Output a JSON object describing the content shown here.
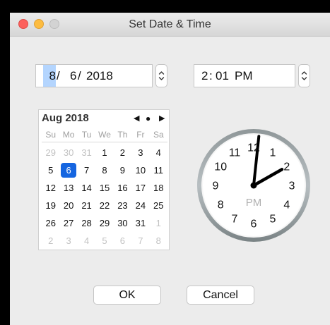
{
  "window": {
    "title": "Set Date & Time"
  },
  "date": {
    "month": "8",
    "day": "6",
    "year": "2018",
    "sep1": "/",
    "sep2": "/"
  },
  "time": {
    "hour": "2",
    "minute": "01",
    "ampm": "PM",
    "sep": ":"
  },
  "calendar": {
    "month_label": "Aug 2018",
    "nav_prev": "◀",
    "nav_today": "●",
    "nav_next": "▶",
    "weekdays": [
      "Su",
      "Mo",
      "Tu",
      "We",
      "Th",
      "Fr",
      "Sa"
    ],
    "weeks": [
      [
        "29",
        "30",
        "31",
        "1",
        "2",
        "3",
        "4"
      ],
      [
        "5",
        "6",
        "7",
        "8",
        "9",
        "10",
        "11"
      ],
      [
        "12",
        "13",
        "14",
        "15",
        "16",
        "17",
        "18"
      ],
      [
        "19",
        "20",
        "21",
        "22",
        "23",
        "24",
        "25"
      ],
      [
        "26",
        "27",
        "28",
        "29",
        "30",
        "31",
        "1"
      ],
      [
        "2",
        "3",
        "4",
        "5",
        "6",
        "7",
        "8"
      ]
    ],
    "other_month": [
      [
        true,
        true,
        true,
        false,
        false,
        false,
        false
      ],
      [
        false,
        false,
        false,
        false,
        false,
        false,
        false
      ],
      [
        false,
        false,
        false,
        false,
        false,
        false,
        false
      ],
      [
        false,
        false,
        false,
        false,
        false,
        false,
        false
      ],
      [
        false,
        false,
        false,
        false,
        false,
        false,
        true
      ],
      [
        true,
        true,
        true,
        true,
        true,
        true,
        true
      ]
    ],
    "selected_day": "6"
  },
  "clock": {
    "numbers": [
      "12",
      "1",
      "2",
      "3",
      "4",
      "5",
      "6",
      "7",
      "8",
      "9",
      "10",
      "11"
    ],
    "period_label": "PM",
    "hour": 2,
    "minute": 1,
    "second_hand_visible": false
  },
  "buttons": {
    "ok_label": "OK",
    "cancel_label": "Cancel"
  },
  "colors": {
    "traffic_close": "#fc605c",
    "traffic_min": "#fdbc40",
    "traffic_max": "#d3d3d3",
    "selection": "#1565e0",
    "field_selection": "#b4d5fe"
  }
}
